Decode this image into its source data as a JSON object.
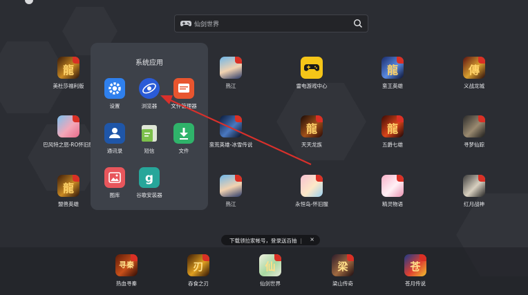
{
  "search": {
    "placeholder": "仙剑世界"
  },
  "folder": {
    "title": "系统应用",
    "apps": [
      {
        "label": "设置",
        "icon": "gear-icon",
        "color": "#2f80ed"
      },
      {
        "label": "浏览器",
        "icon": "globe-icon",
        "color": "#2a5bd7"
      },
      {
        "label": "文件管理器",
        "icon": "file-manager-icon",
        "color": "#e8552f"
      },
      {
        "label": "通讯录",
        "icon": "contacts-icon",
        "color": "#1f56a8"
      },
      {
        "label": "短信",
        "icon": "message-icon",
        "color": "#7cc04b"
      },
      {
        "label": "文件",
        "icon": "download-icon",
        "color": "#2fb36a"
      },
      {
        "label": "图库",
        "icon": "gallery-icon",
        "color": "#e8565c"
      },
      {
        "label": "谷歌安装器",
        "icon": "google-installer-icon",
        "color": "#27a69a"
      }
    ]
  },
  "grid_apps": [
    {
      "label": "美杜莎福利版",
      "icon": "game-icon"
    },
    {
      "label": "热江",
      "icon": "game-icon"
    },
    {
      "label": "雷电游戏中心",
      "icon": "gamepad-icon"
    },
    {
      "label": "蛮王英雄",
      "icon": "game-icon"
    },
    {
      "label": "义战龙城",
      "icon": "game-icon"
    },
    {
      "label": "巴风特之怒-RO怀旧服",
      "icon": "game-icon"
    },
    {
      "label": "蛮荒英雄-冰雪传说",
      "icon": "game-icon"
    },
    {
      "label": "天天龙族",
      "icon": "game-icon"
    },
    {
      "label": "五爵七雄",
      "icon": "game-icon"
    },
    {
      "label": "寻梦仙踪",
      "icon": "game-icon"
    },
    {
      "label": "盟兽英雄",
      "icon": "game-icon"
    },
    {
      "label": "热江",
      "icon": "game-icon"
    },
    {
      "label": "永恒岛-怀旧服",
      "icon": "game-icon"
    },
    {
      "label": "精灵物语",
      "icon": "game-icon"
    },
    {
      "label": "红月战神",
      "icon": "game-icon"
    }
  ],
  "toast": {
    "text": "下载领拉家帐号，登录送百抽",
    "sep": "|",
    "close": "×"
  },
  "dock_apps": [
    {
      "label": "热血寻秦",
      "glyph": "寻秦"
    },
    {
      "label": "吞食之刃",
      "glyph": "刃"
    },
    {
      "label": "仙剑世界",
      "glyph": "仙"
    },
    {
      "label": "梁山传奇",
      "glyph": "梁"
    },
    {
      "label": "苍月传说",
      "glyph": "苍"
    }
  ],
  "grid_glyphs": [
    "龍",
    "",
    "",
    "龍",
    "傳",
    "",
    "",
    "龍",
    "龍",
    "",
    "龍",
    "",
    "",
    "",
    ""
  ]
}
